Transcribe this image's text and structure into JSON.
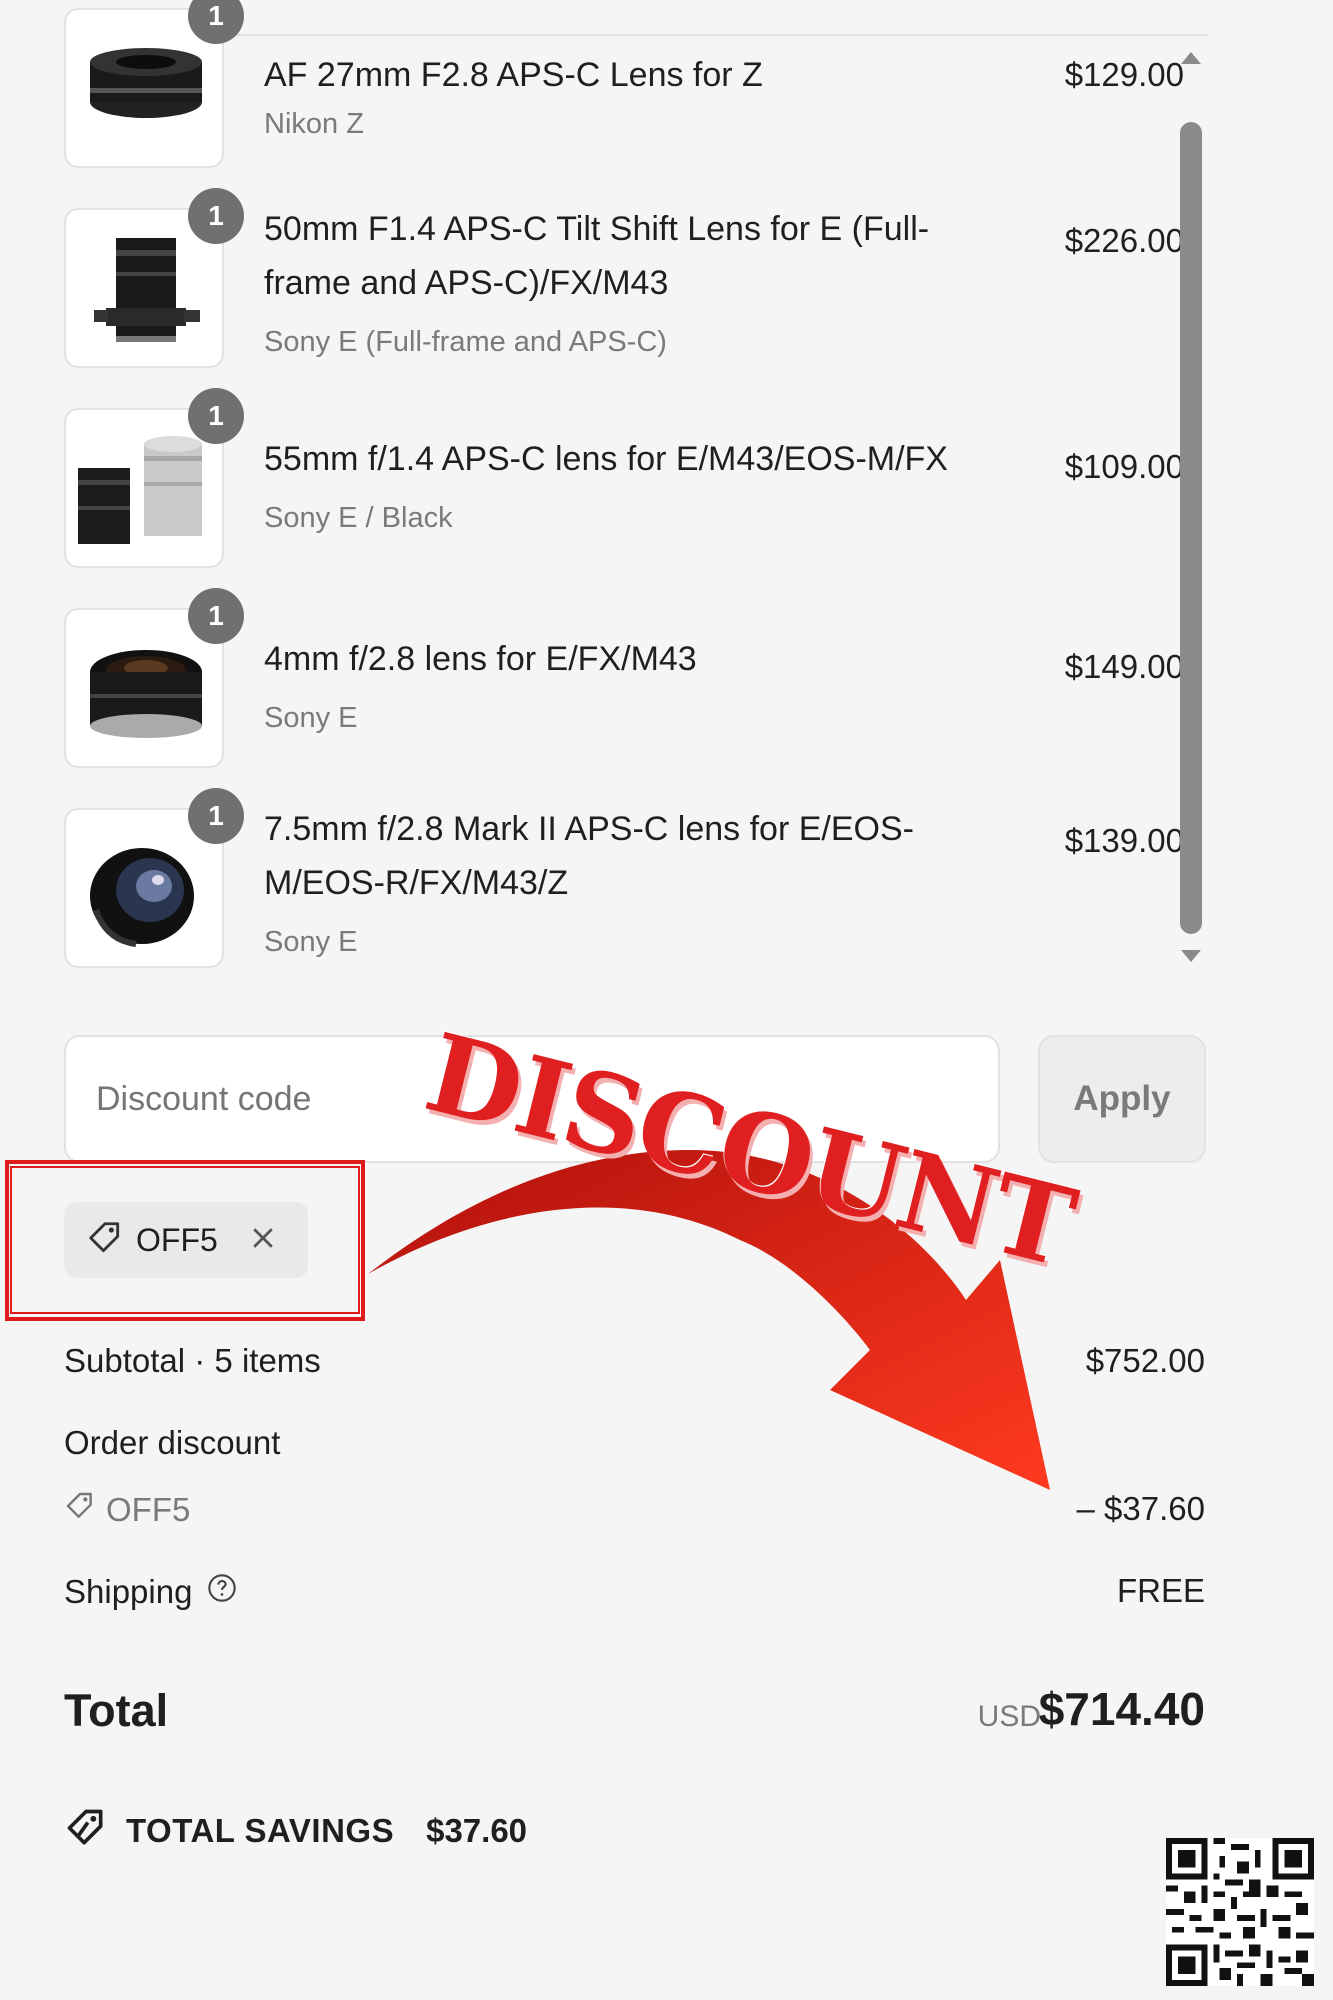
{
  "cart": {
    "items": [
      {
        "title": "AF 27mm F2.8 APS-C Lens for Z",
        "variant": "Nikon Z",
        "price": "$129.00",
        "qty": "1"
      },
      {
        "title": "50mm F1.4 APS-C Tilt Shift Lens for E (Full-frame and APS-C)/FX/M43",
        "variant": "Sony E (Full-frame and APS-C)",
        "price": "$226.00",
        "qty": "1"
      },
      {
        "title": "55mm f/1.4 APS-C lens for E/M43/EOS-M/FX",
        "variant": "Sony E / Black",
        "price": "$109.00",
        "qty": "1"
      },
      {
        "title": "4mm f/2.8 lens for E/FX/M43",
        "variant": "Sony E",
        "price": "$149.00",
        "qty": "1"
      },
      {
        "title": "7.5mm f/2.8 Mark II APS-C lens for E/EOS-M/EOS-R/FX/M43/Z",
        "variant": "Sony E",
        "price": "$139.00",
        "qty": "1"
      }
    ]
  },
  "discount": {
    "placeholder": "Discount code",
    "apply_label": "Apply",
    "applied_code": "OFF5"
  },
  "summary": {
    "subtotal_label": "Subtotal · 5 items",
    "subtotal_value": "$752.00",
    "order_discount_label": "Order discount",
    "order_discount_code": "OFF5",
    "order_discount_value": "– $37.60",
    "shipping_label": "Shipping",
    "shipping_value": "FREE",
    "total_label": "Total",
    "total_currency": "USD",
    "total_value": "$714.40",
    "savings_label": "TOTAL SAVINGS",
    "savings_value": "$37.60"
  },
  "overlay": {
    "stamp_text": "DISCOUNT",
    "accent_color": "#e02020"
  }
}
